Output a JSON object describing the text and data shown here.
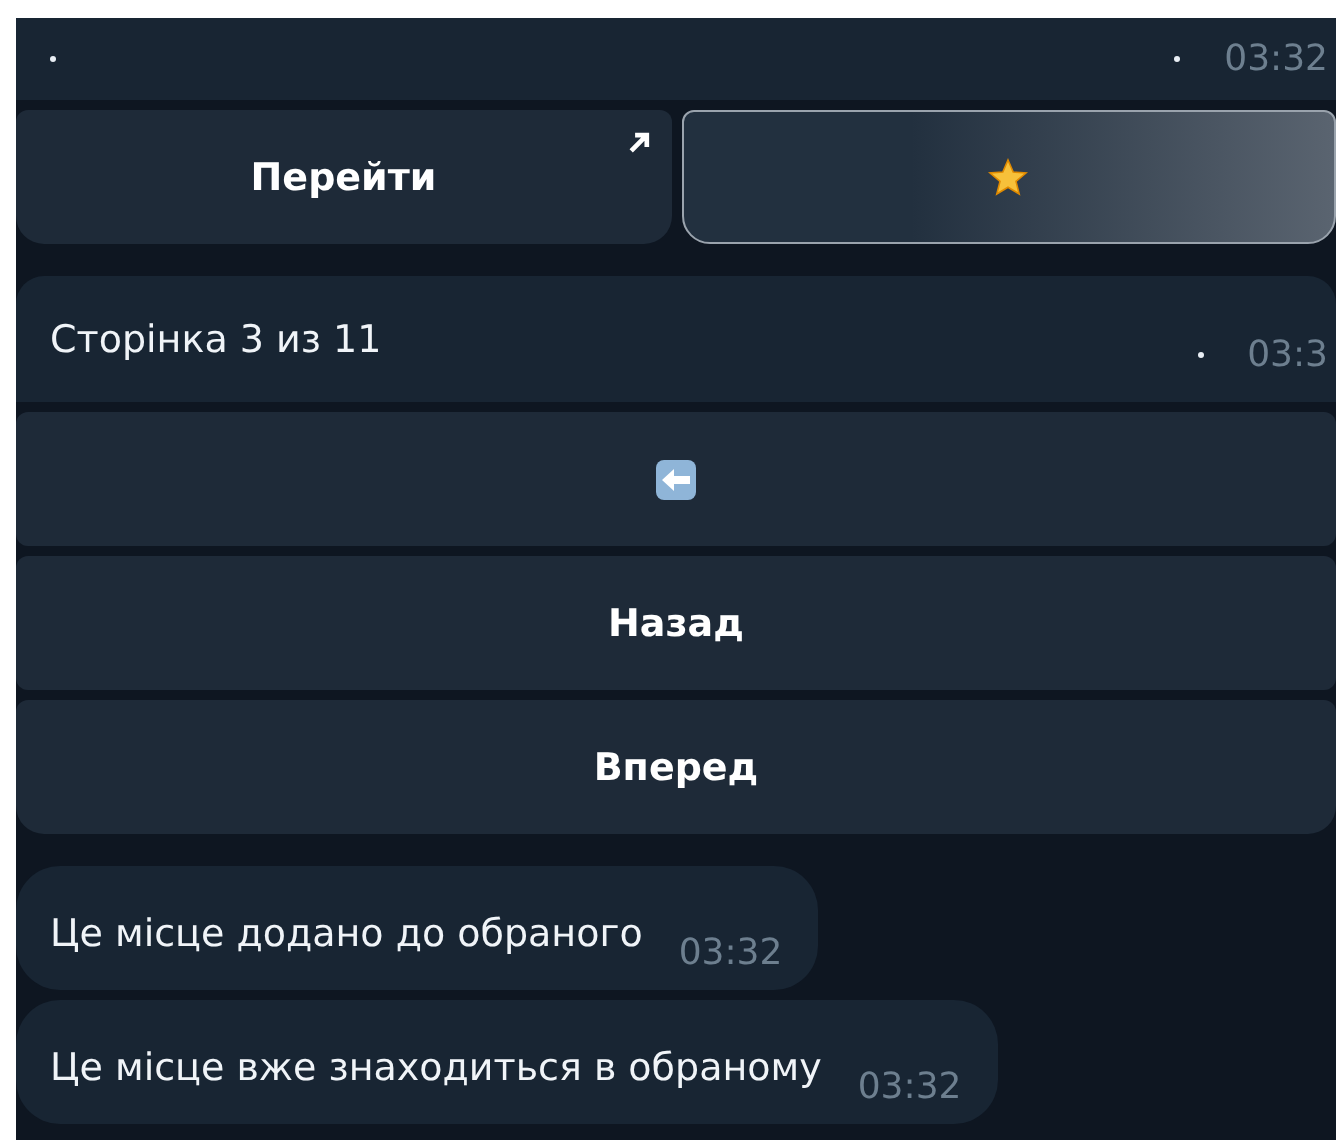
{
  "messages": [
    {
      "lead_dot": true,
      "dot": true,
      "time": "03:32",
      "keyboard": [
        [
          {
            "kind": "text",
            "label": "Перейти",
            "link": true,
            "selected": false
          },
          {
            "kind": "star",
            "selected": true
          }
        ]
      ]
    },
    {
      "text": "Сторінка 3 из 11",
      "dot": true,
      "time": "03:3",
      "keyboard": [
        [
          {
            "kind": "back-arrow",
            "selected": false
          }
        ],
        [
          {
            "kind": "text",
            "label": "Назад",
            "link": false,
            "selected": false
          }
        ],
        [
          {
            "kind": "text",
            "label": "Вперед",
            "link": false,
            "selected": false
          }
        ]
      ]
    },
    {
      "text": "Це місце додано до обраного",
      "time": "03:32"
    },
    {
      "text": "Це місце вже знаходиться в обраному",
      "time": "03:32"
    }
  ]
}
